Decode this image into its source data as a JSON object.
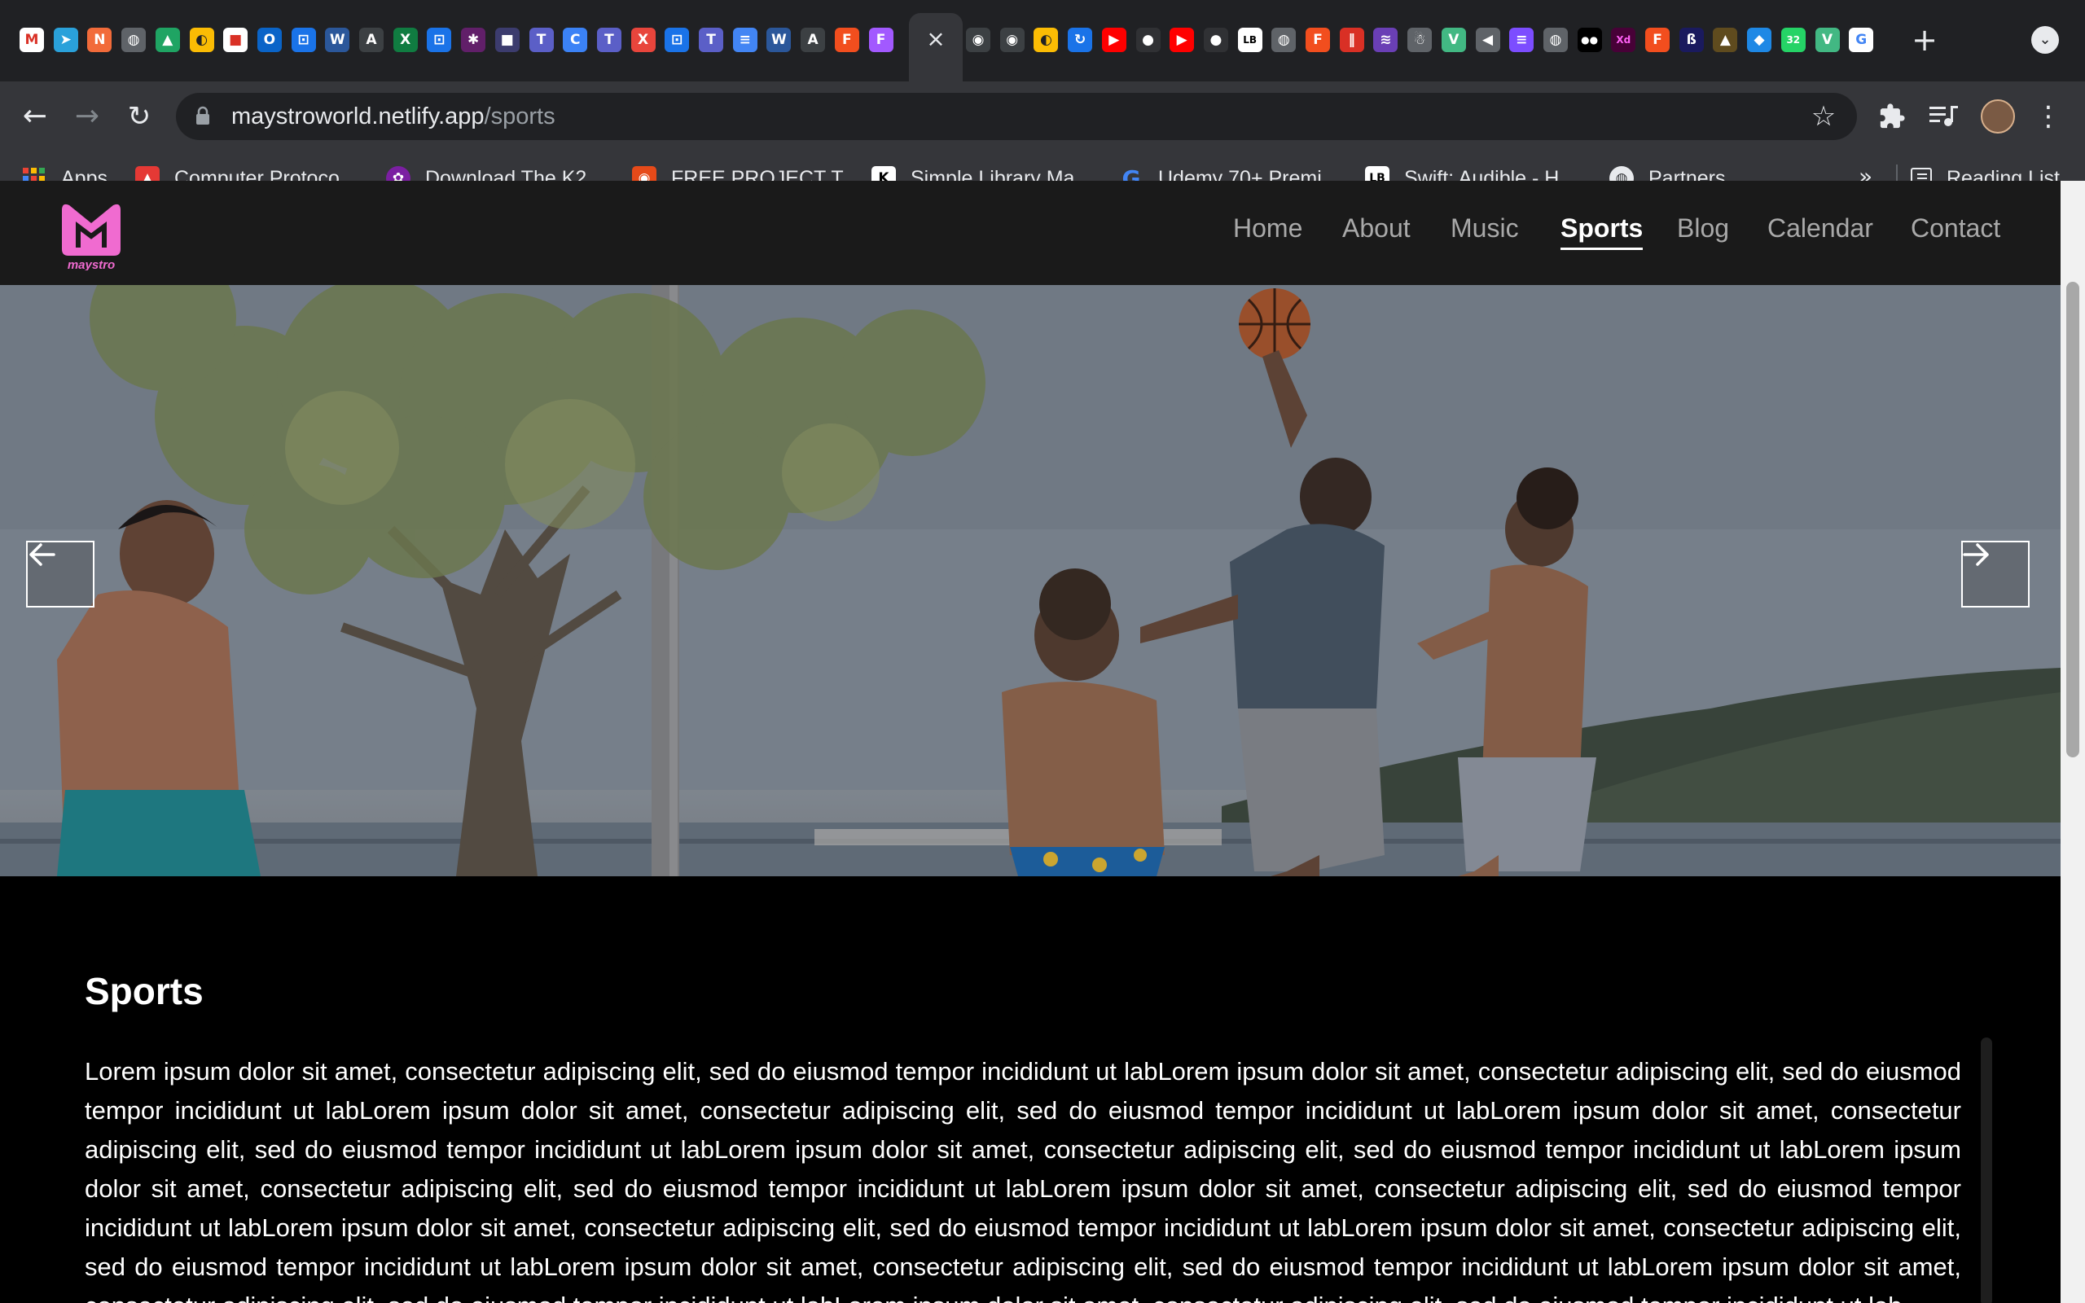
{
  "browser": {
    "tabs": [
      {
        "icon": "gmail-icon",
        "glyph": "M",
        "color": "#ffffff",
        "fg": "#d93025"
      },
      {
        "icon": "telegram-icon",
        "glyph": "➤",
        "color": "#2aa1da"
      },
      {
        "icon": "app-icon",
        "glyph": "N",
        "color": "#f26b3a"
      },
      {
        "icon": "globe-icon",
        "glyph": "◍",
        "color": "#5f6368"
      },
      {
        "icon": "google-drive-icon",
        "glyph": "▲",
        "color": "#1fa463"
      },
      {
        "icon": "app-icon",
        "glyph": "◐",
        "color": "#fbbc04",
        "fg": "#202124"
      },
      {
        "icon": "app-icon",
        "glyph": "■",
        "color": "#ffffff",
        "fg": "#d93025"
      },
      {
        "icon": "outlook-icon",
        "glyph": "O",
        "color": "#0a64c8"
      },
      {
        "icon": "app-icon",
        "glyph": "⊡",
        "color": "#1a73e8"
      },
      {
        "icon": "word-icon",
        "glyph": "W",
        "color": "#2b579a"
      },
      {
        "icon": "asetect-icon",
        "glyph": "A",
        "color": "#3c4043"
      },
      {
        "icon": "excel-icon",
        "glyph": "X",
        "color": "#107c41"
      },
      {
        "icon": "app-icon",
        "glyph": "⊡",
        "color": "#1a73e8"
      },
      {
        "icon": "slack-icon",
        "glyph": "✱",
        "color": "#611f69"
      },
      {
        "icon": "app-icon",
        "glyph": "■",
        "color": "#3c3c6e"
      },
      {
        "icon": "teams-icon",
        "glyph": "T",
        "color": "#5b5fc7"
      },
      {
        "icon": "app-icon",
        "glyph": "C",
        "color": "#3b82f6"
      },
      {
        "icon": "teams-icon",
        "glyph": "T",
        "color": "#5b5fc7"
      },
      {
        "icon": "app-icon",
        "glyph": "X",
        "color": "#e8453c"
      },
      {
        "icon": "app-icon",
        "glyph": "⊡",
        "color": "#1a73e8"
      },
      {
        "icon": "teams-icon",
        "glyph": "T",
        "color": "#5b5fc7"
      },
      {
        "icon": "docs-icon",
        "glyph": "≡",
        "color": "#4285f4"
      },
      {
        "icon": "word-icon",
        "glyph": "W",
        "color": "#2b579a"
      },
      {
        "icon": "asetect-icon",
        "glyph": "A",
        "color": "#3c4043"
      },
      {
        "icon": "figma-icon",
        "glyph": "F",
        "color": "#f24e1e"
      },
      {
        "icon": "figma-icon",
        "glyph": "F",
        "color": "#a259ff"
      }
    ],
    "tabs_right": [
      {
        "icon": "github-icon",
        "glyph": "◉",
        "color": "#3c4043"
      },
      {
        "icon": "github-icon",
        "glyph": "◉",
        "color": "#3c4043"
      },
      {
        "icon": "app-icon",
        "glyph": "◐",
        "color": "#fbbc04",
        "fg": "#202124"
      },
      {
        "icon": "app-icon",
        "glyph": "↻",
        "color": "#1a73e8"
      },
      {
        "icon": "youtube-icon",
        "glyph": "▶",
        "color": "#ff0000"
      },
      {
        "icon": "app-icon",
        "glyph": "●",
        "color": "#303134"
      },
      {
        "icon": "youtube-icon",
        "glyph": "▶",
        "color": "#ff0000"
      },
      {
        "icon": "app-icon",
        "glyph": "●",
        "color": "#303134"
      },
      {
        "icon": "lb-icon",
        "glyph": "LB",
        "color": "#ffffff",
        "fg": "#000000"
      },
      {
        "icon": "globe-icon",
        "glyph": "◍",
        "color": "#5f6368"
      },
      {
        "icon": "figma-icon",
        "glyph": "F",
        "color": "#f24e1e"
      },
      {
        "icon": "app-icon",
        "glyph": "‖",
        "color": "#d93025"
      },
      {
        "icon": "app-icon",
        "glyph": "≋",
        "color": "#6a3fb5"
      },
      {
        "icon": "app-icon",
        "glyph": "☃",
        "color": "#5f6368"
      },
      {
        "icon": "vue-icon",
        "glyph": "V",
        "color": "#42b883"
      },
      {
        "icon": "speaker-icon",
        "glyph": "◀",
        "color": "#5f6368"
      },
      {
        "icon": "app-icon",
        "glyph": "≡",
        "color": "#7c4dff"
      },
      {
        "icon": "globe-icon",
        "glyph": "◍",
        "color": "#5f6368"
      },
      {
        "icon": "medium-icon",
        "glyph": "●●",
        "color": "#000000"
      },
      {
        "icon": "xd-icon",
        "glyph": "Xd",
        "color": "#470137",
        "fg": "#ff61f6"
      },
      {
        "icon": "figma-icon",
        "glyph": "F",
        "color": "#f24e1e"
      },
      {
        "icon": "app-icon",
        "glyph": "ß",
        "color": "#1a1a5e"
      },
      {
        "icon": "app-icon",
        "glyph": "▲",
        "color": "#5f4b1e"
      },
      {
        "icon": "app-icon",
        "glyph": "◆",
        "color": "#1e88e5"
      },
      {
        "icon": "whatsapp-icon",
        "glyph": "32",
        "color": "#25d366"
      },
      {
        "icon": "vue-icon",
        "glyph": "V",
        "color": "#42b883"
      },
      {
        "icon": "google-icon",
        "glyph": "G",
        "color": "#ffffff",
        "fg": "#4285f4"
      }
    ],
    "address": {
      "host": "maystroworld.netlify.app",
      "path": "/sports"
    },
    "bookmarks": [
      {
        "label": "Apps",
        "icon": "apps-grid-icon",
        "color": "#ea4335"
      },
      {
        "label": "Computer Protoco...",
        "icon": "bookmark-icon",
        "color": "#e53935"
      },
      {
        "label": "Download The K2...",
        "icon": "bookmark-icon",
        "color": "#7b1fa2"
      },
      {
        "label": "FREE PROJECT T...",
        "icon": "bookmark-icon",
        "color": "#e64a19"
      },
      {
        "label": "Simple Library Ma...",
        "icon": "bookmark-icon",
        "color": "#ffffff"
      },
      {
        "label": "Udemy 70+ Premi...",
        "icon": "google-icon",
        "color": "#ffffff"
      },
      {
        "label": "Swift: Audible - H...",
        "icon": "lb-icon",
        "color": "#ffffff"
      },
      {
        "label": "Partners",
        "icon": "globe-icon",
        "color": "#e8eaed"
      }
    ],
    "bookmarks_overflow": "»",
    "reading_list": "Reading List"
  },
  "site": {
    "logo_text": "maystro",
    "brand_color": "#f06bd0",
    "nav": [
      "Home",
      "About",
      "Music",
      "Sports",
      "Blog",
      "Calendar",
      "Contact"
    ],
    "active_nav": "Sports",
    "hero": {
      "prev_icon": "arrow-left-icon",
      "next_icon": "arrow-right-icon"
    },
    "section": {
      "title": "Sports",
      "body": "Lorem ipsum dolor sit amet, consectetur adipiscing elit, sed do eiusmod tempor incididunt ut labLorem ipsum dolor sit amet, consectetur adipiscing elit, sed do eiusmod tempor incididunt ut labLorem ipsum dolor sit amet, consectetur adipiscing elit, sed do eiusmod tempor incididunt ut labLorem ipsum dolor sit amet, consectetur adipiscing elit, sed do eiusmod tempor incididunt ut labLorem ipsum dolor sit amet, consectetur adipiscing elit, sed do eiusmod tempor incididunt ut labLorem ipsum dolor sit amet, consectetur adipiscing elit, sed do eiusmod tempor incididunt ut labLorem ipsum dolor sit amet, consectetur adipiscing elit, sed do eiusmod tempor incididunt ut labLorem ipsum dolor sit amet, consectetur adipiscing elit, sed do eiusmod tempor incididunt ut labLorem ipsum dolor sit amet, consectetur adipiscing elit, sed do eiusmod tempor incididunt ut labLorem ipsum dolor sit amet, consectetur adipiscing elit, sed do eiusmod tempor incididunt ut labLorem ipsum dolor sit amet, consectetur adipiscing elit, sed do eiusmod tempor incididunt ut labLorem ipsum dolor sit amet, consectetur adipiscing elit, sed do eiusmod tempor incididunt ut lab"
    }
  }
}
